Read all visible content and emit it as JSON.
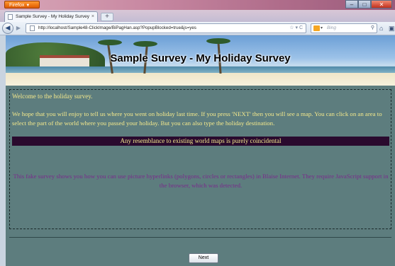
{
  "browser": {
    "app_button": "Firefox",
    "tab_title": "Sample Survey - My Holiday Survey",
    "new_tab_symbol": "+",
    "url": "http://localhost/Sample48-ClickImage/BiPagHan.asp?PopupBlocked=true&js=yes",
    "search_placeholder": "Bing",
    "icons": [
      "firefox-menu-icon",
      "back-icon",
      "forward-icon",
      "page-icon",
      "bookmark-star-icon",
      "reload-icon",
      "bing-icon",
      "search-icon",
      "home-icon",
      "minimize-icon",
      "maximize-icon",
      "close-icon"
    ]
  },
  "banner": {
    "title": "Sample Survey - My Holiday Survey"
  },
  "survey": {
    "welcome": "Welcome to the holiday survey.",
    "intro": "We hope that you will enjoy to tell us where you went on holiday last time. If you press 'NEXT' then you will see a map. You can click on an area to select the part of the world where you passed your holiday. But you can also type the holiday destination.",
    "notice": "Any resemblance to existing world maps is purely coincidental",
    "info": "This fake survey shows you how you can use picture hyperlinks (polygons, circles or rectangles) in Blaise Internet. They require JavaScript support in the browser, which was detected.",
    "next_label": "Next"
  },
  "colors": {
    "panel_bg": "#5d7d7e",
    "text_yellow": "#f4e98c",
    "info_purple": "#7a2a8c",
    "notice_bg": "#2a0a2e"
  }
}
